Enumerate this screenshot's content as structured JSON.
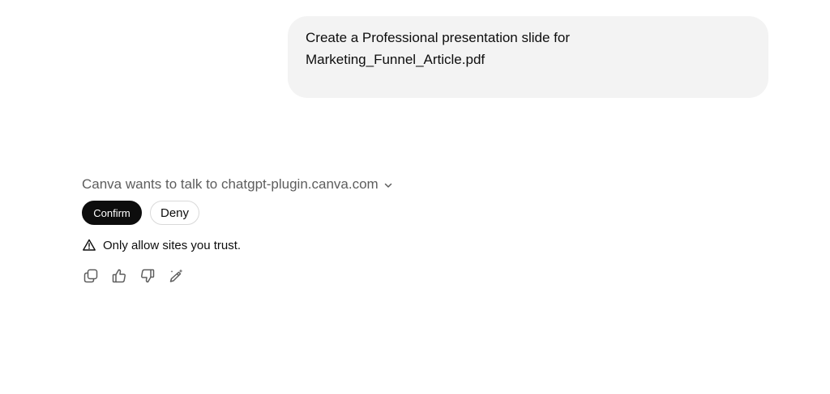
{
  "user_message": {
    "text": "Create a Professional presentation slide for\nMarketing_Funnel_Article.pdf"
  },
  "assistant": {
    "plugin_request": "Canva wants to talk to chatgpt-plugin.canva.com",
    "confirm_label": "Confirm",
    "deny_label": "Deny",
    "warning_text": "Only allow sites you trust.",
    "action_icons": [
      "copy-icon",
      "thumbs-up-icon",
      "thumbs-down-icon",
      "edit-sparkle-icon"
    ]
  },
  "colors": {
    "bubble_bg": "#f3f3f3",
    "confirm_bg": "#0d0d0d",
    "muted_text": "#5d5d5d"
  }
}
